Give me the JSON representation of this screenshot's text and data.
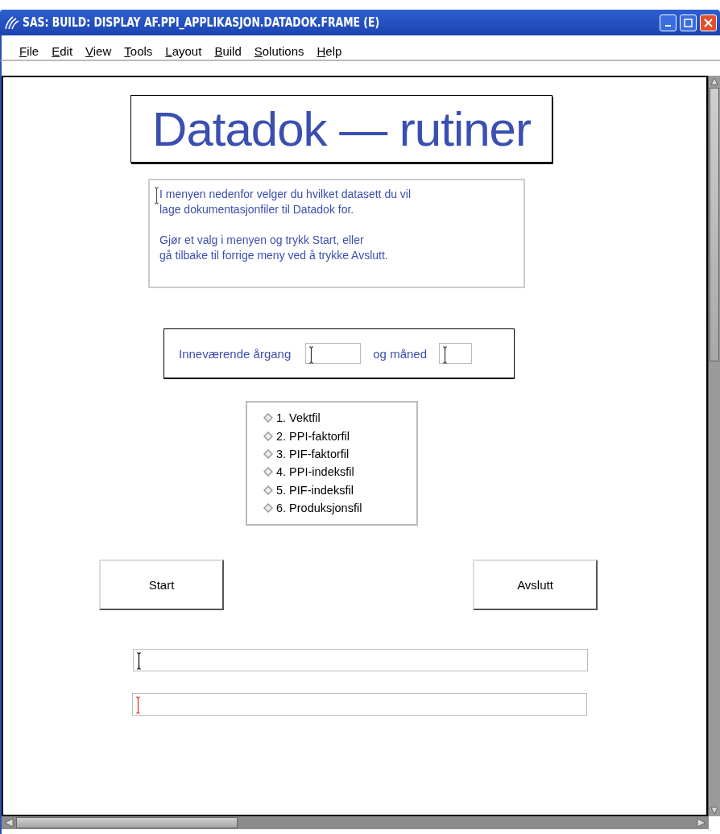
{
  "window": {
    "title": "SAS: BUILD: DISPLAY AF.PPI_APPLIKASJON.DATADOK.FRAME (E)"
  },
  "menu": [
    "File",
    "Edit",
    "View",
    "Tools",
    "Layout",
    "Build",
    "Solutions",
    "Help"
  ],
  "heading": "Datadok — rutiner",
  "intro": [
    "I menyen nedenfor velger du hvilket datasett du vil\nlage dokumentasjonfiler til Datadok for.",
    "Gjør et valg i menyen og trykk Start, eller\ngå tilbake til forrige meny ved å trykke Avslutt."
  ],
  "period": {
    "year_label": "Inneværende årgang",
    "month_label": "og måned"
  },
  "options": [
    {
      "label": "1. Vektfil",
      "selected": false
    },
    {
      "label": "2. PPI-faktorfil",
      "selected": false
    },
    {
      "label": "3. PIF-faktorfil",
      "selected": false
    },
    {
      "label": "4. PPI-indeksfil",
      "selected": false
    },
    {
      "label": "5. PIF-indeksfil",
      "selected": false
    },
    {
      "label": "6. Produksjonsfil",
      "selected": false
    }
  ],
  "buttons": [
    "Start",
    "Avslutt"
  ],
  "message_fields": [
    {
      "color": "#000000"
    },
    {
      "color": "#e03030"
    }
  ]
}
